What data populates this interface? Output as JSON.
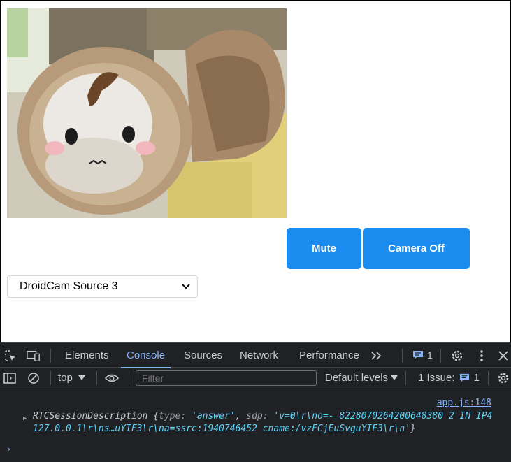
{
  "page": {
    "buttons": {
      "mute_label": "Mute",
      "camera_label": "Camera Off"
    },
    "camera_select": {
      "selected": "DroidCam Source 3"
    }
  },
  "devtools": {
    "tabs": [
      "Elements",
      "Console",
      "Sources",
      "Network",
      "Performance"
    ],
    "active_tab": "Console",
    "more_tabs_icon": "chevron-double-right-icon",
    "messages_count": "1",
    "toolbar": {
      "context": "top",
      "filter_placeholder": "Filter",
      "levels": "Default levels",
      "issues_label": "1 Issue:",
      "issues_count": "1"
    },
    "console": {
      "source_link": "app.js:148",
      "object_name": "RTCSessionDescription",
      "open_brace": " {",
      "type_key": "type",
      "type_value": "'answer'",
      "sdp_key": "sdp",
      "sdp_value": "'v=0\\r\\no=- 8228070264200648380 2 IN IP4 127.0.0.1\\r\\ns…uYIF3\\r\\na=ssrc:1940746452 cname:/vzFCjEuSvguYIF3\\r\\n'",
      "close_brace": "}"
    }
  },
  "colors": {
    "button_blue": "#1a8cf0",
    "devtools_bg": "#202124",
    "accent_blue": "#8ab4f8",
    "string_cyan": "#5cd5fb"
  }
}
